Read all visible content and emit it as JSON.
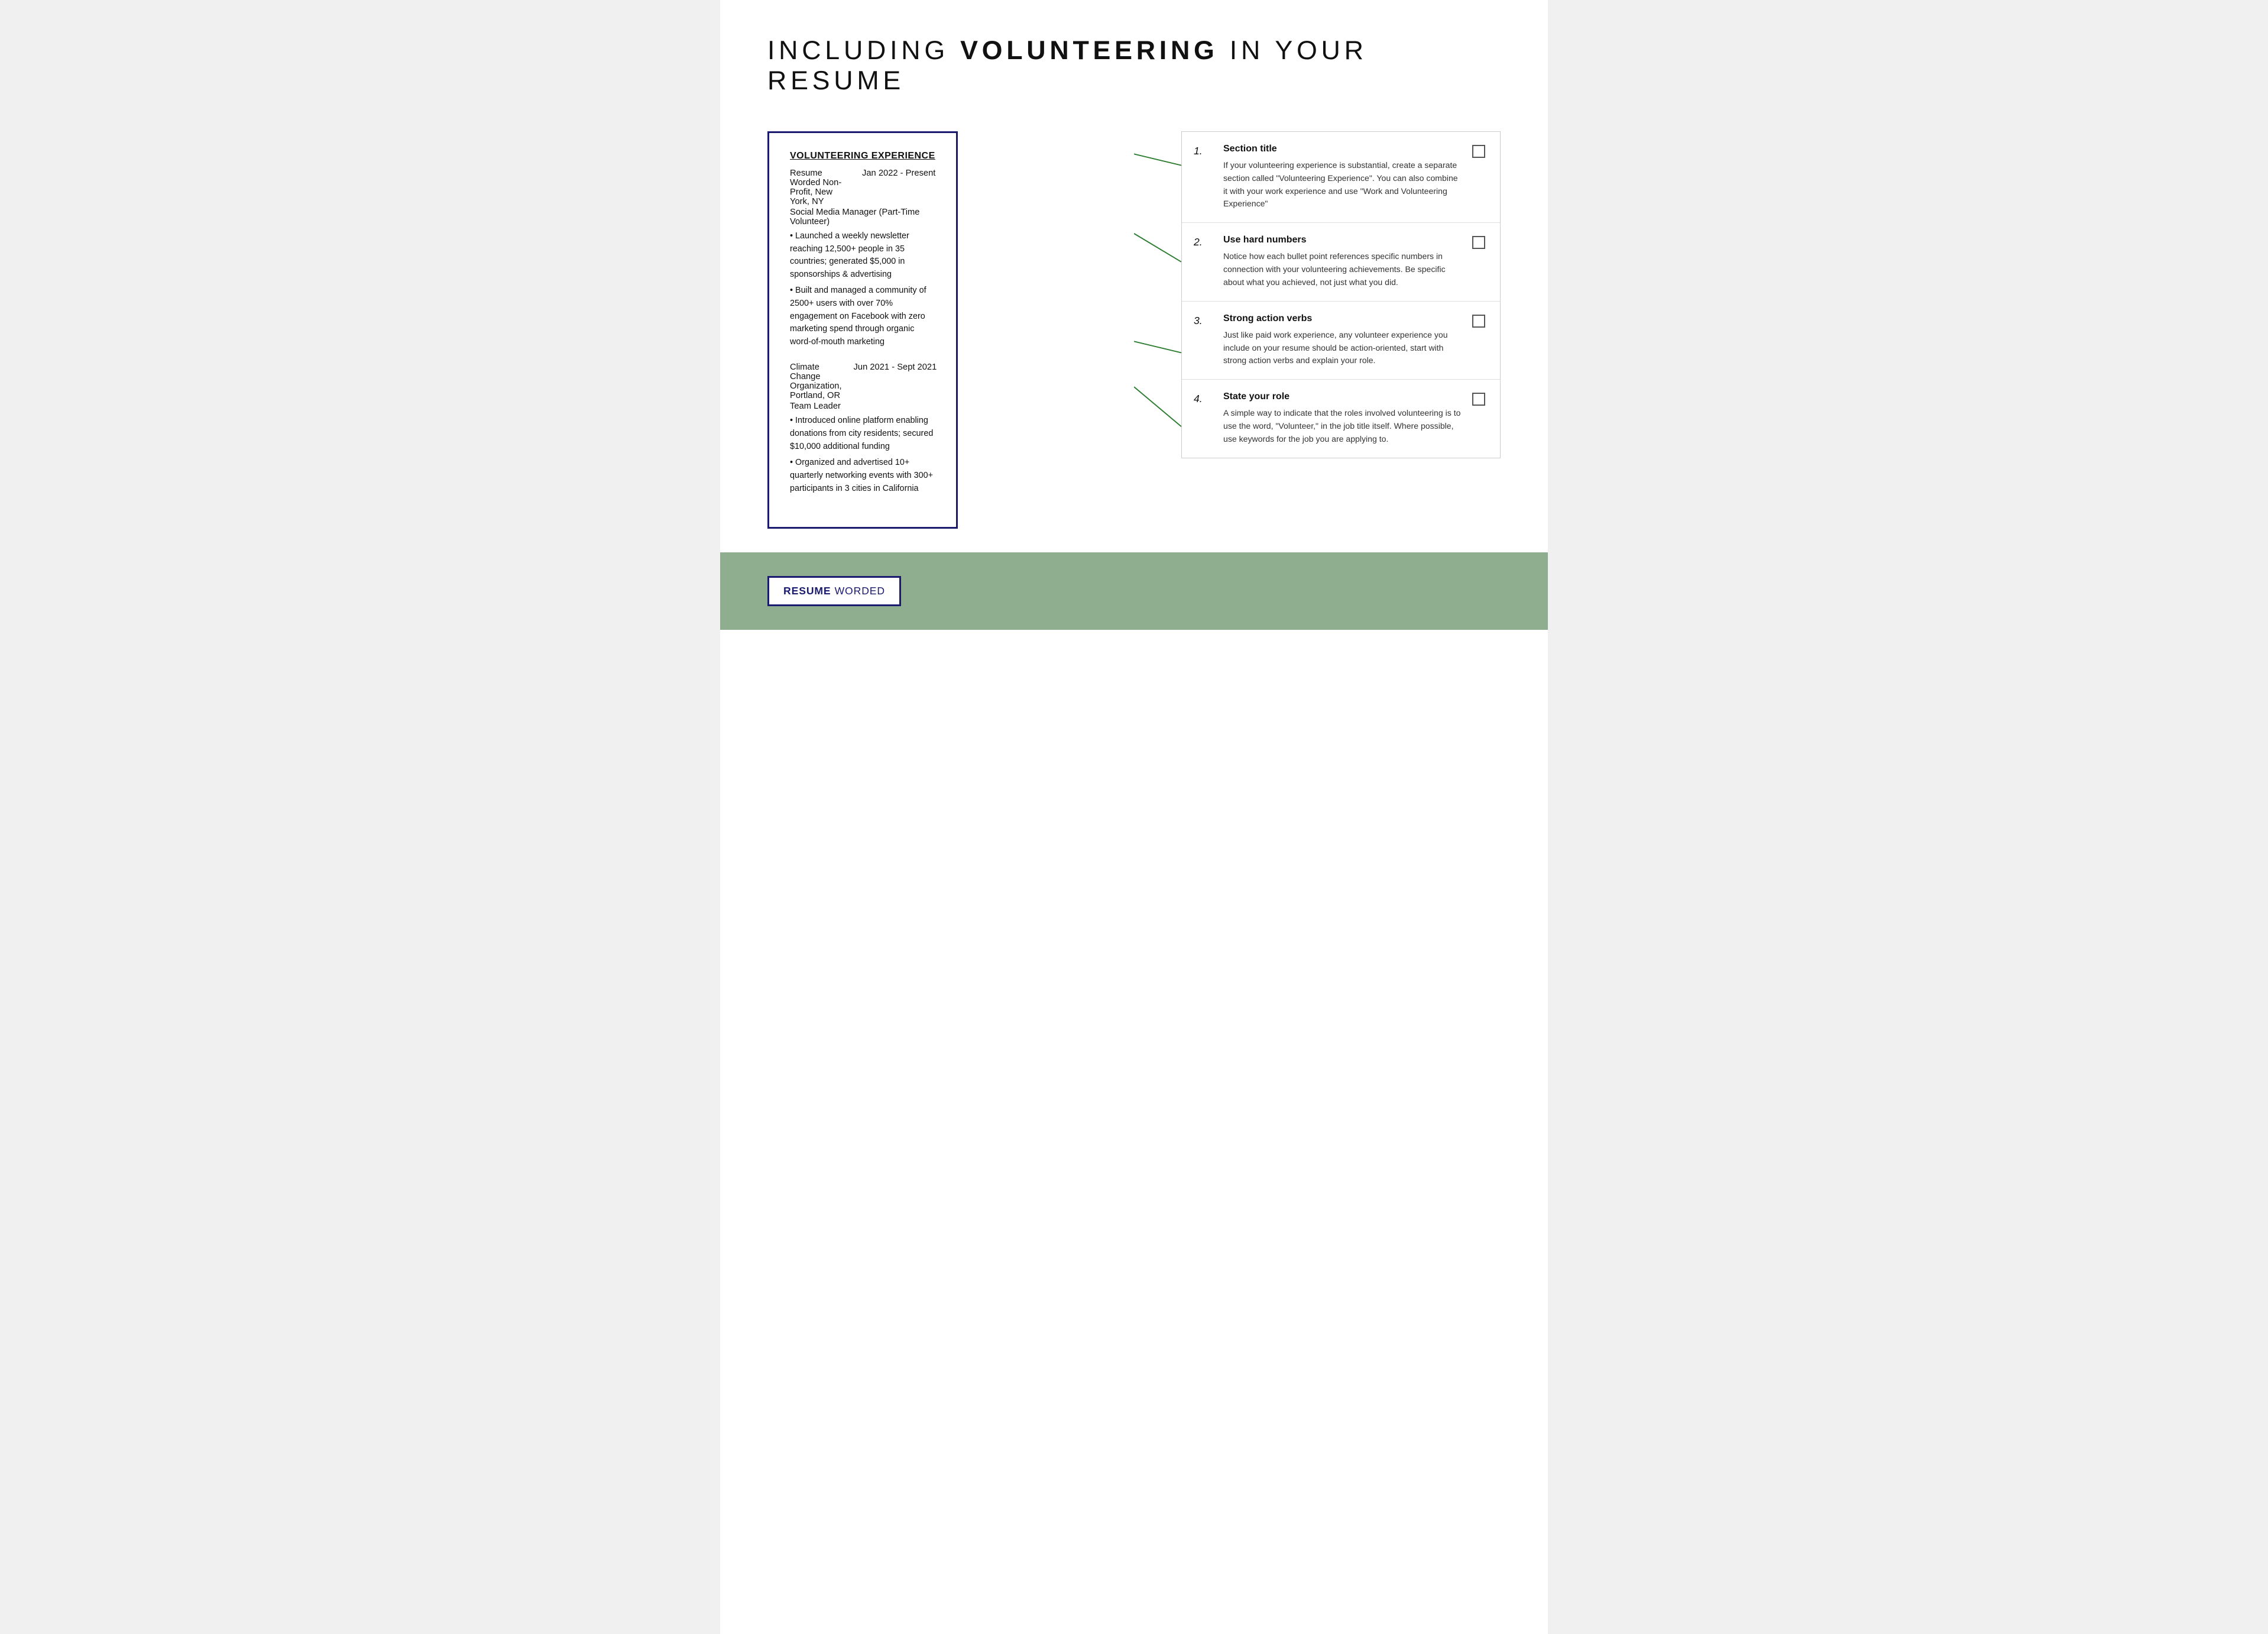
{
  "page": {
    "title_prefix": "INCLUDING ",
    "title_bold": "VOLUNTEERING",
    "title_suffix": " IN YOUR RESUME"
  },
  "resume": {
    "section_title": "VOLUNTEERING EXPERIENCE",
    "entries": [
      {
        "org": "Resume Worded Non-Profit, New York, NY",
        "dates": "Jan 2022 - Present",
        "role": "Social Media Manager (Part-Time Volunteer)",
        "bullets": [
          "Launched a weekly newsletter reaching 12,500+ people in 35 countries; generated $5,000 in sponsorships & advertising",
          "Built and managed a community of 2500+ users with over 70% engagement on Facebook with zero marketing spend through organic word-of-mouth marketing"
        ]
      },
      {
        "org": "Climate Change Organization, Portland, OR",
        "dates": "Jun 2021 - Sept 2021",
        "role": "Team Leader",
        "bullets": [
          "Introduced online platform enabling donations from city residents; secured $10,000 additional funding",
          "Organized and advertised 10+ quarterly networking events with 300+ participants in 3 cities in California"
        ]
      }
    ]
  },
  "tips": [
    {
      "number": "1.",
      "title": "Section title",
      "text": "If your volunteering experience is substantial, create a separate section called \"Volunteering Experience\". You can also combine it with your work experience and use \"Work and Volunteering Experience\""
    },
    {
      "number": "2.",
      "title": "Use hard numbers",
      "text": "Notice how each bullet point references specific numbers in connection with your volunteering achievements. Be specific about what you achieved, not just what you did."
    },
    {
      "number": "3.",
      "title": "Strong action verbs",
      "text": "Just like paid work experience, any volunteer experience you include on your resume should be action-oriented, start with strong action verbs and explain your role."
    },
    {
      "number": "4.",
      "title": "State your role",
      "text": "A simple way to indicate that the roles involved volunteering is to use the word, \"Volunteer,\" in the job title itself. Where possible, use keywords for the job you are applying to."
    }
  ],
  "logo": {
    "resume": "RESUME",
    "worded": "WORDED"
  },
  "colors": {
    "dark_blue": "#1a1a6e",
    "green": "#2e7d32",
    "light_green_bg": "#8fad8f"
  }
}
